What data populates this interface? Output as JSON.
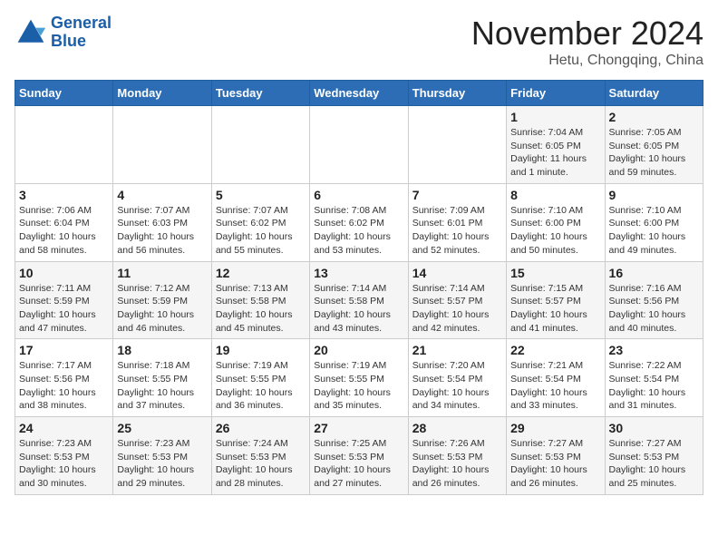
{
  "header": {
    "logo_line1": "General",
    "logo_line2": "Blue",
    "month_title": "November 2024",
    "location": "Hetu, Chongqing, China"
  },
  "days_of_week": [
    "Sunday",
    "Monday",
    "Tuesday",
    "Wednesday",
    "Thursday",
    "Friday",
    "Saturday"
  ],
  "weeks": [
    [
      {
        "day": "",
        "info": ""
      },
      {
        "day": "",
        "info": ""
      },
      {
        "day": "",
        "info": ""
      },
      {
        "day": "",
        "info": ""
      },
      {
        "day": "",
        "info": ""
      },
      {
        "day": "1",
        "info": "Sunrise: 7:04 AM\nSunset: 6:05 PM\nDaylight: 11 hours and 1 minute."
      },
      {
        "day": "2",
        "info": "Sunrise: 7:05 AM\nSunset: 6:05 PM\nDaylight: 10 hours and 59 minutes."
      }
    ],
    [
      {
        "day": "3",
        "info": "Sunrise: 7:06 AM\nSunset: 6:04 PM\nDaylight: 10 hours and 58 minutes."
      },
      {
        "day": "4",
        "info": "Sunrise: 7:07 AM\nSunset: 6:03 PM\nDaylight: 10 hours and 56 minutes."
      },
      {
        "day": "5",
        "info": "Sunrise: 7:07 AM\nSunset: 6:02 PM\nDaylight: 10 hours and 55 minutes."
      },
      {
        "day": "6",
        "info": "Sunrise: 7:08 AM\nSunset: 6:02 PM\nDaylight: 10 hours and 53 minutes."
      },
      {
        "day": "7",
        "info": "Sunrise: 7:09 AM\nSunset: 6:01 PM\nDaylight: 10 hours and 52 minutes."
      },
      {
        "day": "8",
        "info": "Sunrise: 7:10 AM\nSunset: 6:00 PM\nDaylight: 10 hours and 50 minutes."
      },
      {
        "day": "9",
        "info": "Sunrise: 7:10 AM\nSunset: 6:00 PM\nDaylight: 10 hours and 49 minutes."
      }
    ],
    [
      {
        "day": "10",
        "info": "Sunrise: 7:11 AM\nSunset: 5:59 PM\nDaylight: 10 hours and 47 minutes."
      },
      {
        "day": "11",
        "info": "Sunrise: 7:12 AM\nSunset: 5:59 PM\nDaylight: 10 hours and 46 minutes."
      },
      {
        "day": "12",
        "info": "Sunrise: 7:13 AM\nSunset: 5:58 PM\nDaylight: 10 hours and 45 minutes."
      },
      {
        "day": "13",
        "info": "Sunrise: 7:14 AM\nSunset: 5:58 PM\nDaylight: 10 hours and 43 minutes."
      },
      {
        "day": "14",
        "info": "Sunrise: 7:14 AM\nSunset: 5:57 PM\nDaylight: 10 hours and 42 minutes."
      },
      {
        "day": "15",
        "info": "Sunrise: 7:15 AM\nSunset: 5:57 PM\nDaylight: 10 hours and 41 minutes."
      },
      {
        "day": "16",
        "info": "Sunrise: 7:16 AM\nSunset: 5:56 PM\nDaylight: 10 hours and 40 minutes."
      }
    ],
    [
      {
        "day": "17",
        "info": "Sunrise: 7:17 AM\nSunset: 5:56 PM\nDaylight: 10 hours and 38 minutes."
      },
      {
        "day": "18",
        "info": "Sunrise: 7:18 AM\nSunset: 5:55 PM\nDaylight: 10 hours and 37 minutes."
      },
      {
        "day": "19",
        "info": "Sunrise: 7:19 AM\nSunset: 5:55 PM\nDaylight: 10 hours and 36 minutes."
      },
      {
        "day": "20",
        "info": "Sunrise: 7:19 AM\nSunset: 5:55 PM\nDaylight: 10 hours and 35 minutes."
      },
      {
        "day": "21",
        "info": "Sunrise: 7:20 AM\nSunset: 5:54 PM\nDaylight: 10 hours and 34 minutes."
      },
      {
        "day": "22",
        "info": "Sunrise: 7:21 AM\nSunset: 5:54 PM\nDaylight: 10 hours and 33 minutes."
      },
      {
        "day": "23",
        "info": "Sunrise: 7:22 AM\nSunset: 5:54 PM\nDaylight: 10 hours and 31 minutes."
      }
    ],
    [
      {
        "day": "24",
        "info": "Sunrise: 7:23 AM\nSunset: 5:53 PM\nDaylight: 10 hours and 30 minutes."
      },
      {
        "day": "25",
        "info": "Sunrise: 7:23 AM\nSunset: 5:53 PM\nDaylight: 10 hours and 29 minutes."
      },
      {
        "day": "26",
        "info": "Sunrise: 7:24 AM\nSunset: 5:53 PM\nDaylight: 10 hours and 28 minutes."
      },
      {
        "day": "27",
        "info": "Sunrise: 7:25 AM\nSunset: 5:53 PM\nDaylight: 10 hours and 27 minutes."
      },
      {
        "day": "28",
        "info": "Sunrise: 7:26 AM\nSunset: 5:53 PM\nDaylight: 10 hours and 26 minutes."
      },
      {
        "day": "29",
        "info": "Sunrise: 7:27 AM\nSunset: 5:53 PM\nDaylight: 10 hours and 26 minutes."
      },
      {
        "day": "30",
        "info": "Sunrise: 7:27 AM\nSunset: 5:53 PM\nDaylight: 10 hours and 25 minutes."
      }
    ]
  ]
}
